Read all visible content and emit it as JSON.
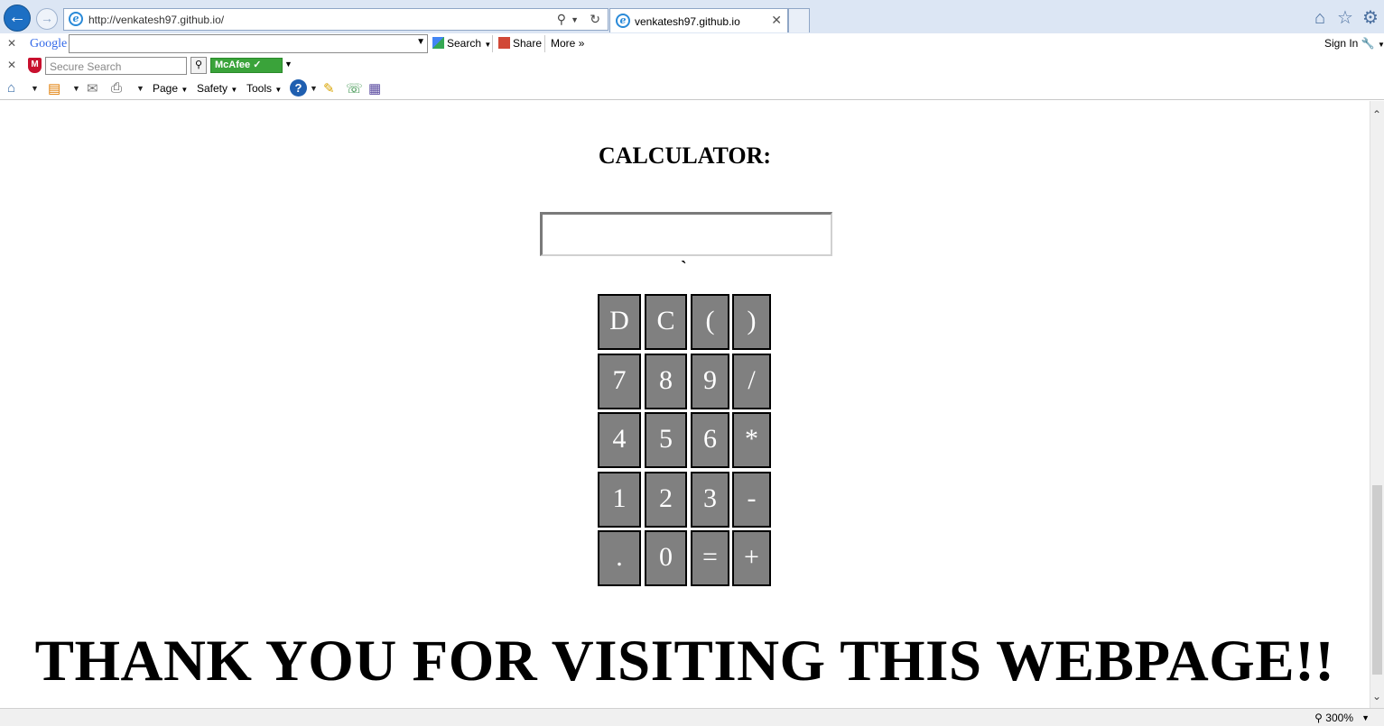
{
  "browser": {
    "url": "http://venkatesh97.github.io/",
    "tab_title": "venkatesh97.github.io"
  },
  "google_toolbar": {
    "logo": "Google",
    "search_label": "Search",
    "share_label": "Share",
    "more_label": "More",
    "sign_in_label": "Sign In"
  },
  "mcafee_toolbar": {
    "search_placeholder": "Secure Search",
    "badge_label": "McAfee"
  },
  "command_bar": {
    "page_label": "Page",
    "safety_label": "Safety",
    "tools_label": "Tools"
  },
  "page": {
    "title": "CALCULATOR:",
    "display_value": "",
    "stray_char": "`",
    "keys": [
      [
        "D",
        "C",
        "(",
        ")"
      ],
      [
        "7",
        "8",
        "9",
        "/"
      ],
      [
        "4",
        "5",
        "6",
        "*"
      ],
      [
        "1",
        "2",
        "3",
        "-"
      ],
      [
        ".",
        "0",
        "=",
        "+"
      ]
    ],
    "footer": "THANK YOU FOR VISITING THIS WEBPAGE!!"
  },
  "statusbar": {
    "zoom": "300%"
  },
  "colors": {
    "key_bg": "#808080",
    "key_text": "#ffffff",
    "key_border": "#000000"
  }
}
